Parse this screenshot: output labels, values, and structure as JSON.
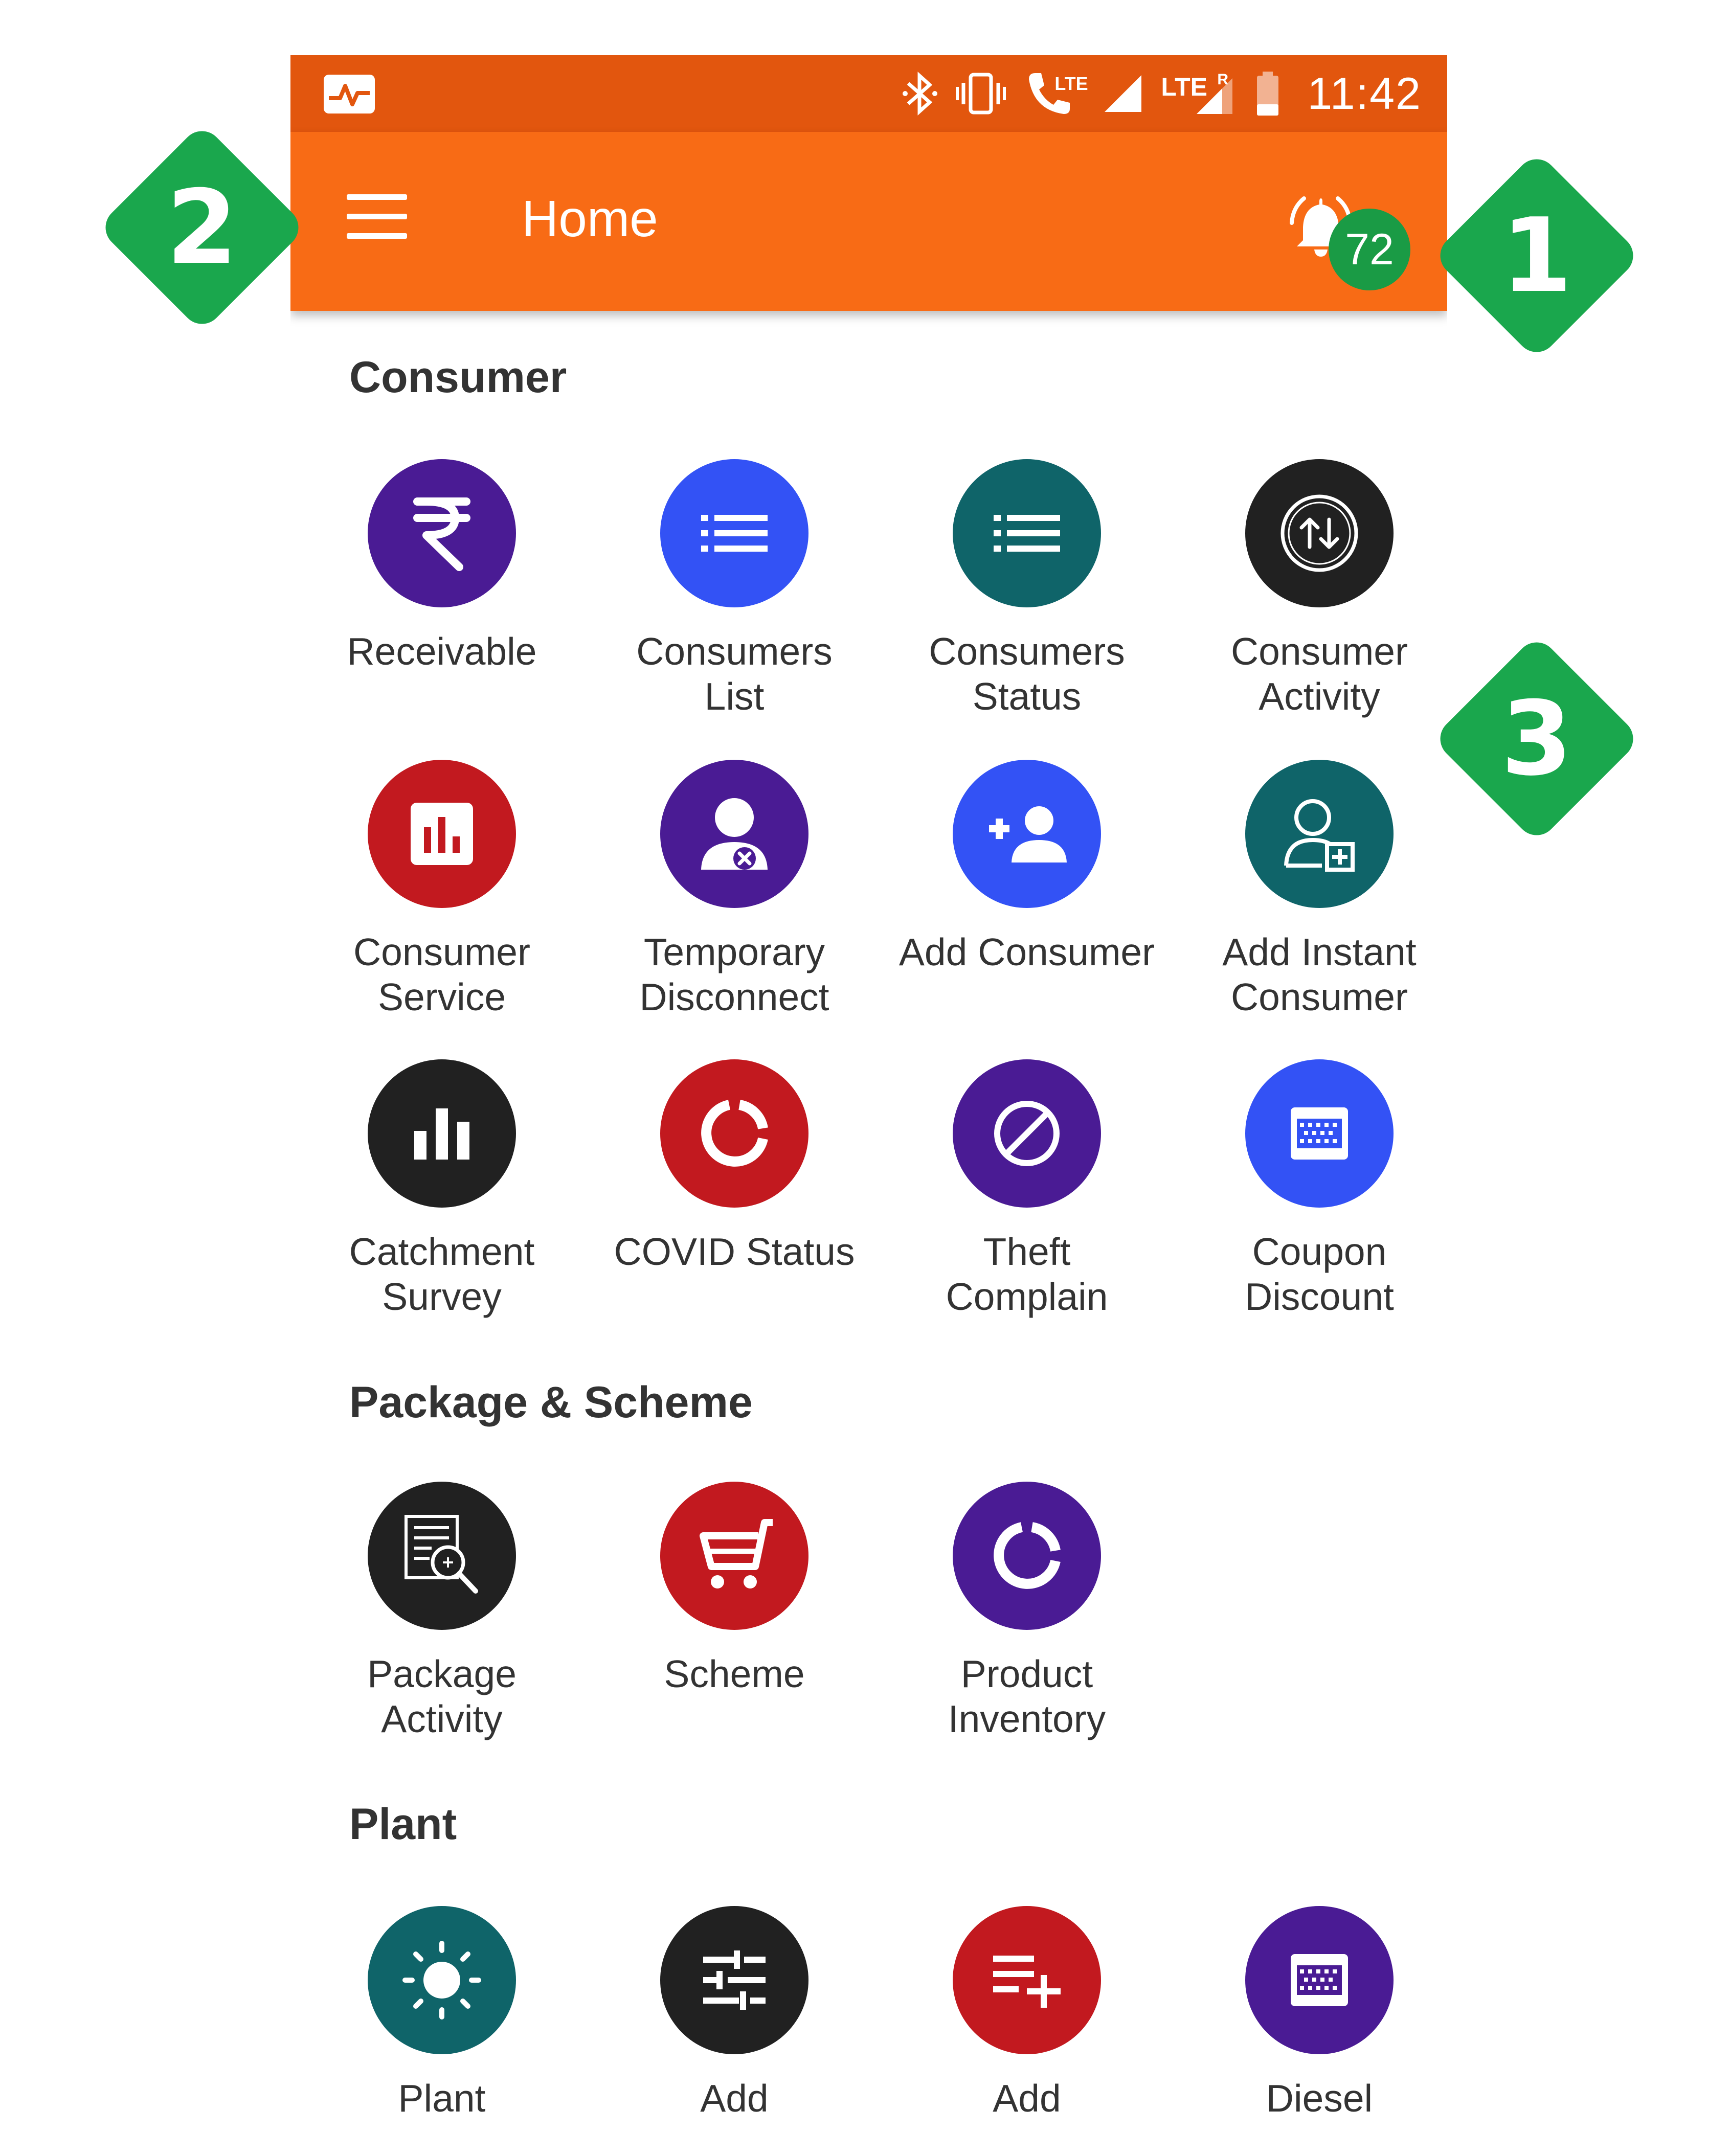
{
  "status_bar": {
    "time": "11:42",
    "icons": [
      "activity-icon",
      "bluetooth-icon",
      "vibrate-icon",
      "volte-call-icon",
      "signal-icon",
      "lte-signal-icon",
      "battery-icon"
    ],
    "lte_label": "LTE",
    "roaming_label": "R"
  },
  "app_bar": {
    "title": "Home",
    "menu_icon": "hamburger-menu-icon",
    "notification_icon": "bell-icon",
    "notification_count": "72",
    "background": "#f86b15"
  },
  "sections": [
    {
      "title": "Consumer",
      "items": [
        {
          "label": "Receivable",
          "icon": "rupee-icon",
          "color": "#4a1b94"
        },
        {
          "label": "Consumers\nList",
          "icon": "list-icon",
          "color": "#3352f5"
        },
        {
          "label": "Consumers\nStatus",
          "icon": "list-icon",
          "color": "#0f6469"
        },
        {
          "label": "Consumer\nActivity",
          "icon": "swap-vertical-icon",
          "color": "#212121"
        },
        {
          "label": "Consumer\nService",
          "icon": "chart-box-icon",
          "color": "#c2191f"
        },
        {
          "label": "Temporary\nDisconnect",
          "icon": "user-remove-icon",
          "color": "#4a1b94"
        },
        {
          "label": "Add Consumer",
          "icon": "add-user-icon",
          "color": "#3352f5"
        },
        {
          "label": "Add Instant\nConsumer",
          "icon": "user-plus-outline-icon",
          "color": "#0f6469"
        },
        {
          "label": "Catchment\nSurvey",
          "icon": "bar-chart-icon",
          "color": "#212121"
        },
        {
          "label": "COVID Status",
          "icon": "donut-icon",
          "color": "#c2191f"
        },
        {
          "label": "Theft\nComplain",
          "icon": "block-icon",
          "color": "#4a1b94"
        },
        {
          "label": "Coupon\nDiscount",
          "icon": "coupon-icon",
          "color": "#3352f5"
        }
      ]
    },
    {
      "title": "Package & Scheme",
      "items": [
        {
          "label": "Package\nActivity",
          "icon": "document-search-icon",
          "color": "#212121"
        },
        {
          "label": "Scheme",
          "icon": "cart-icon",
          "color": "#c2191f"
        },
        {
          "label": "Product\nInventory",
          "icon": "donut-icon",
          "color": "#4a1b94"
        }
      ]
    },
    {
      "title": "Plant",
      "items": [
        {
          "label": "Plant",
          "icon": "sun-icon",
          "color": "#0f6469"
        },
        {
          "label": "Add",
          "icon": "sliders-icon",
          "color": "#212121"
        },
        {
          "label": "Add",
          "icon": "playlist-add-icon",
          "color": "#c2191f"
        },
        {
          "label": "Diesel",
          "icon": "coupon-icon",
          "color": "#4a1b94"
        }
      ]
    }
  ],
  "callouts": [
    {
      "number": "1",
      "color": "#1aa74d"
    },
    {
      "number": "2",
      "color": "#1aa74d"
    },
    {
      "number": "3",
      "color": "#1aa74d"
    }
  ]
}
